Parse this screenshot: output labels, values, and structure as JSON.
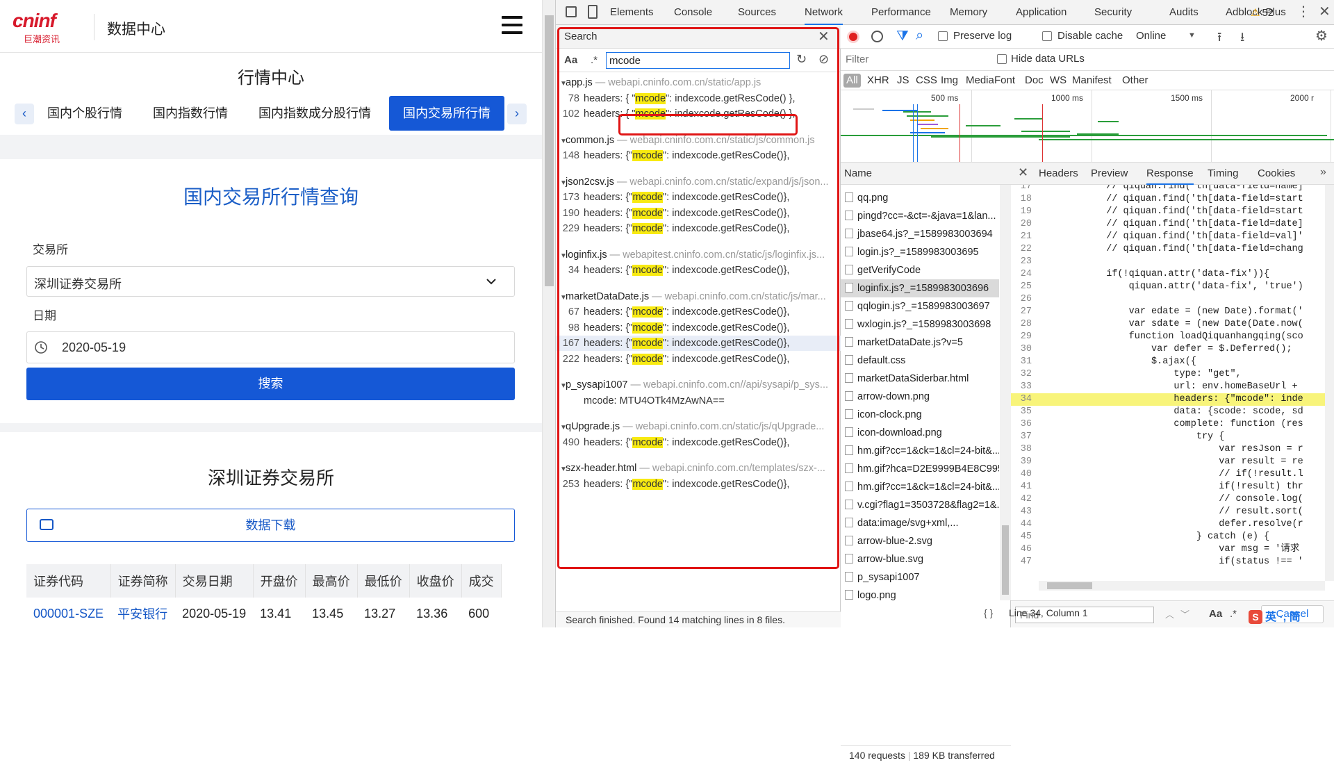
{
  "site": {
    "logo": "cninf",
    "logo_sub": "巨潮资讯",
    "title": "数据中心"
  },
  "market": {
    "title": "行情中心",
    "tabs": [
      "国内个股行情",
      "国内指数行情",
      "国内指数成分股行情",
      "国内交易所行情"
    ],
    "active_tab": 3
  },
  "form": {
    "title": "国内交易所行情查询",
    "exchange_label": "交易所",
    "exchange_value": "深圳证券交易所",
    "date_label": "日期",
    "date_value": "2020-05-19",
    "search_label": "搜索"
  },
  "result": {
    "title": "深圳证券交易所",
    "download_label": "数据下载",
    "columns": [
      "证券代码",
      "证券简称",
      "交易日期",
      "开盘价",
      "最高价",
      "最低价",
      "收盘价",
      "成交"
    ],
    "rows": [
      [
        "000001-SZE",
        "平安银行",
        "2020-05-19",
        "13.41",
        "13.45",
        "13.27",
        "13.36",
        "600"
      ]
    ]
  },
  "devtools": {
    "tabs": [
      "Elements",
      "Console",
      "Sources",
      "Network",
      "Performance",
      "Memory",
      "Application",
      "Security",
      "Audits",
      "Adblock Plus"
    ],
    "active_tab": "Network",
    "warnings": "52",
    "search": {
      "header": "Search",
      "aa": "Aa",
      "regex": ".*",
      "query": "mcode",
      "status": "Search finished.  Found 14 matching lines in 8 files.",
      "groups": [
        {
          "file": "app.js",
          "url": " — webapi.cninfo.com.cn/static/app.js",
          "lines": [
            {
              "n": "78",
              "pre": "headers: { \"",
              "hl": "mcode",
              "post": "\": indexcode.getResCode() },"
            },
            {
              "n": "102",
              "pre": "headers: { \"",
              "hl": "mcode",
              "post": "\": indexcode.getResCode() },"
            }
          ]
        },
        {
          "file": "common.js",
          "url": " — webapi.cninfo.com.cn/static/js/common.js",
          "lines": [
            {
              "n": "148",
              "pre": "headers: {\"",
              "hl": "mcode",
              "post": "\": indexcode.getResCode()},"
            }
          ]
        },
        {
          "file": "json2csv.js",
          "url": " — webapi.cninfo.com.cn/static/expand/js/json...",
          "lines": [
            {
              "n": "173",
              "pre": "headers: {\"",
              "hl": "mcode",
              "post": "\": indexcode.getResCode()},"
            },
            {
              "n": "190",
              "pre": "headers: {\"",
              "hl": "mcode",
              "post": "\": indexcode.getResCode()},"
            },
            {
              "n": "229",
              "pre": "headers: {\"",
              "hl": "mcode",
              "post": "\": indexcode.getResCode()},"
            }
          ]
        },
        {
          "file": "loginfix.js",
          "url": " — webapitest.cninfo.com.cn/static/js/loginfix.js...",
          "lines": [
            {
              "n": "34",
              "pre": "headers: {\"",
              "hl": "mcode",
              "post": "\": indexcode.getResCode()},"
            }
          ]
        },
        {
          "file": "marketDataDate.js",
          "url": " — webapi.cninfo.com.cn/static/js/mar...",
          "lines": [
            {
              "n": "67",
              "pre": "headers: {\"",
              "hl": "mcode",
              "post": "\": indexcode.getResCode()},"
            },
            {
              "n": "98",
              "pre": "headers: {\"",
              "hl": "mcode",
              "post": "\": indexcode.getResCode()},"
            },
            {
              "n": "167",
              "pre": "headers: {\"",
              "hl": "mcode",
              "post": "\": indexcode.getResCode()},"
            },
            {
              "n": "222",
              "pre": "headers: {\"",
              "hl": "mcode",
              "post": "\": indexcode.getResCode()},"
            }
          ]
        },
        {
          "file": "p_sysapi1007",
          "url": " — webapi.cninfo.com.cn//api/sysapi/p_sys...",
          "lines": [
            {
              "n": "",
              "pre": "mcode:  MTU4OTk4MzAwNA==",
              "hl": "",
              "post": ""
            }
          ]
        },
        {
          "file": "qUpgrade.js",
          "url": " — webapi.cninfo.com.cn/static/js/qUpgrade...",
          "lines": [
            {
              "n": "490",
              "pre": "headers: {\"",
              "hl": "mcode",
              "post": "\": indexcode.getResCode()},"
            }
          ]
        },
        {
          "file": "szx-header.html",
          "url": " — webapi.cninfo.com.cn/templates/szx-...",
          "lines": [
            {
              "n": "253",
              "pre": "headers: {\"",
              "hl": "mcode",
              "post": "\": indexcode.getResCode()},"
            }
          ]
        }
      ]
    },
    "network": {
      "preserve_log": "Preserve log",
      "disable_cache": "Disable cache",
      "throttle": "Online",
      "filter_placeholder": "Filter",
      "hide_data_urls": "Hide data URLs",
      "types": [
        "All",
        "XHR",
        "JS",
        "CSS",
        "Img",
        "Media",
        "Font",
        "Doc",
        "WS",
        "Manifest",
        "Other"
      ],
      "ticks": [
        "500 ms",
        "1000 ms",
        "1500 ms",
        "2000 r"
      ],
      "name_header": "Name",
      "names": [
        "qq.png",
        "pingd?cc=-&ct=-&java=1&lan...",
        "jbase64.js?_=1589983003694",
        "login.js?_=1589983003695",
        "getVerifyCode",
        "loginfix.js?_=1589983003696",
        "qqlogin.js?_=1589983003697",
        "wxlogin.js?_=1589983003698",
        "marketDataDate.js?v=5",
        "default.css",
        "marketDataSiderbar.html",
        "arrow-down.png",
        "icon-clock.png",
        "icon-download.png",
        "hm.gif?cc=1&ck=1&cl=24-bit&...",
        "hm.gif?hca=D2E9999B4E8C995...",
        "hm.gif?cc=1&ck=1&cl=24-bit&...",
        "v.cgi?flag1=3503728&flag2=1&...",
        "data:image/svg+xml,...",
        "arrow-blue-2.svg",
        "arrow-blue.svg",
        "p_sysapi1007",
        "logo.png"
      ],
      "selected_name": 5,
      "requests": "140 requests",
      "transferred": "189 KB transferred",
      "resp_tabs": [
        "Headers",
        "Preview",
        "Response",
        "Timing",
        "Cookies"
      ],
      "active_resp_tab": "Response",
      "code": [
        {
          "n": "17",
          "t": "            // qiquan.find('th[data-field=name]"
        },
        {
          "n": "18",
          "t": "            // qiquan.find('th[data-field=start"
        },
        {
          "n": "19",
          "t": "            // qiquan.find('th[data-field=start"
        },
        {
          "n": "20",
          "t": "            // qiquan.find('th[data-field=date]"
        },
        {
          "n": "21",
          "t": "            // qiquan.find('th[data-field=val]'"
        },
        {
          "n": "22",
          "t": "            // qiquan.find('th[data-field=chang"
        },
        {
          "n": "23",
          "t": ""
        },
        {
          "n": "24",
          "t": "            if(!qiquan.attr('data-fix')){"
        },
        {
          "n": "25",
          "t": "                qiquan.attr('data-fix', 'true')"
        },
        {
          "n": "26",
          "t": ""
        },
        {
          "n": "27",
          "t": "                var edate = (new Date).format('"
        },
        {
          "n": "28",
          "t": "                var sdate = (new Date(Date.now("
        },
        {
          "n": "29",
          "t": "                function loadQiquanhangqing(sco"
        },
        {
          "n": "30",
          "t": "                    var defer = $.Deferred();"
        },
        {
          "n": "31",
          "t": "                    $.ajax({"
        },
        {
          "n": "32",
          "t": "                        type: \"get\","
        },
        {
          "n": "33",
          "t": "                        url: env.homeBaseUrl +"
        },
        {
          "n": "34",
          "t": "                        headers: {\"mcode\": inde"
        },
        {
          "n": "35",
          "t": "                        data: {scode: scode, sd"
        },
        {
          "n": "36",
          "t": "                        complete: function (res"
        },
        {
          "n": "37",
          "t": "                            try {"
        },
        {
          "n": "38",
          "t": "                                var resJson = r"
        },
        {
          "n": "39",
          "t": "                                var result = re"
        },
        {
          "n": "40",
          "t": "                                // if(!result.l"
        },
        {
          "n": "41",
          "t": "                                if(!result) thr"
        },
        {
          "n": "42",
          "t": "                                // console.log("
        },
        {
          "n": "43",
          "t": "                                // result.sort("
        },
        {
          "n": "44",
          "t": "                                defer.resolve(r"
        },
        {
          "n": "45",
          "t": "                            } catch (e) {"
        },
        {
          "n": "46",
          "t": "                                var msg = '请求"
        },
        {
          "n": "47",
          "t": "                                if(status !== '"
        }
      ],
      "highlight_line": "34",
      "find_placeholder": "Find",
      "find_aa": "Aa",
      "find_regex": ".*",
      "cancel": "Cancel",
      "cursor": "Line 34, Column 1",
      "braces": "{ }",
      "ime": "英 ·, 简"
    }
  }
}
